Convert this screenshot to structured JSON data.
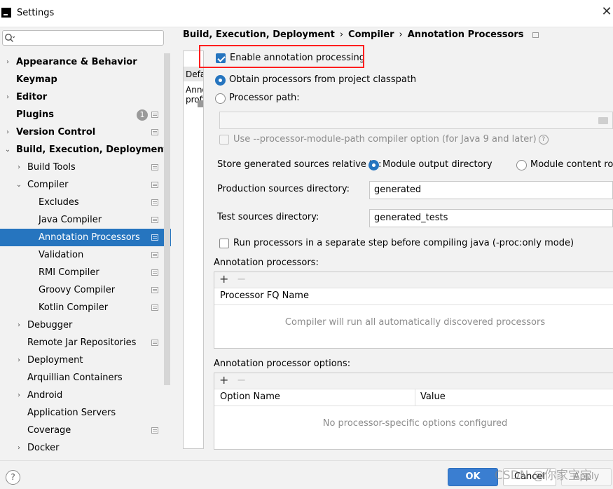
{
  "window": {
    "title": "Settings",
    "close_icon": "close-icon"
  },
  "search": {
    "placeholder": "",
    "icon": "search-icon"
  },
  "sidebar": {
    "items": [
      {
        "label": "Appearance & Behavior",
        "bold": true,
        "arrow": "›"
      },
      {
        "label": "Keymap",
        "bold": true,
        "arrow": ""
      },
      {
        "label": "Editor",
        "bold": true,
        "arrow": "›"
      },
      {
        "label": "Plugins",
        "bold": true,
        "arrow": "",
        "badge": "1"
      },
      {
        "label": "Version Control",
        "bold": true,
        "arrow": "›"
      },
      {
        "label": "Build, Execution, Deployment",
        "bold": true,
        "arrow": "⌄"
      },
      {
        "label": "Build Tools",
        "arrow": "›"
      },
      {
        "label": "Compiler",
        "arrow": "⌄"
      },
      {
        "label": "Excludes",
        "arrow": ""
      },
      {
        "label": "Java Compiler",
        "arrow": ""
      },
      {
        "label": "Annotation Processors",
        "arrow": "",
        "selected": true
      },
      {
        "label": "Validation",
        "arrow": ""
      },
      {
        "label": "RMI Compiler",
        "arrow": ""
      },
      {
        "label": "Groovy Compiler",
        "arrow": ""
      },
      {
        "label": "Kotlin Compiler",
        "arrow": ""
      },
      {
        "label": "Debugger",
        "arrow": "›"
      },
      {
        "label": "Remote Jar Repositories",
        "arrow": ""
      },
      {
        "label": "Deployment",
        "arrow": "›"
      },
      {
        "label": "Arquillian Containers",
        "arrow": ""
      },
      {
        "label": "Android",
        "arrow": "›"
      },
      {
        "label": "Application Servers",
        "arrow": ""
      },
      {
        "label": "Coverage",
        "arrow": ""
      },
      {
        "label": "Docker",
        "arrow": "›"
      }
    ]
  },
  "breadcrumb": {
    "part1": "Build, Execution, Deployment",
    "part2": "Compiler",
    "part3": "Annotation Processors",
    "sep": "›"
  },
  "profiles": {
    "header": "Default",
    "row": "Annotation profile"
  },
  "options": {
    "enable_annotation": "Enable annotation processing",
    "obtain_from_classpath": "Obtain processors from project classpath",
    "processor_path": "Processor path:",
    "processor_path_value": "",
    "module_path_option": "Use --processor-module-path compiler option (for Java 9 and later)",
    "store_generated_label": "Store generated sources relative to:",
    "module_output_dir": "Module output directory",
    "module_content_root": "Module content root",
    "production_sources_label": "Production sources directory:",
    "production_sources_value": "generated",
    "test_sources_label": "Test sources directory:",
    "test_sources_value": "generated_tests",
    "run_separate": "Run processors in a separate step before compiling java (-proc:only mode)"
  },
  "processors": {
    "title": "Annotation processors:",
    "plus": "+",
    "minus": "−",
    "column": "Processor FQ Name",
    "empty": "Compiler will run all automatically discovered processors"
  },
  "processor_options": {
    "title": "Annotation processor options:",
    "plus": "+",
    "minus": "−",
    "col1": "Option Name",
    "col2": "Value",
    "empty": "No processor-specific options configured"
  },
  "footer": {
    "help": "?",
    "ok": "OK",
    "cancel": "Cancel",
    "apply": "Apply"
  },
  "watermark": "CSDN @你家宝宝",
  "colors": {
    "accent": "#2675bf",
    "highlight_box": "#ff1e1e"
  }
}
